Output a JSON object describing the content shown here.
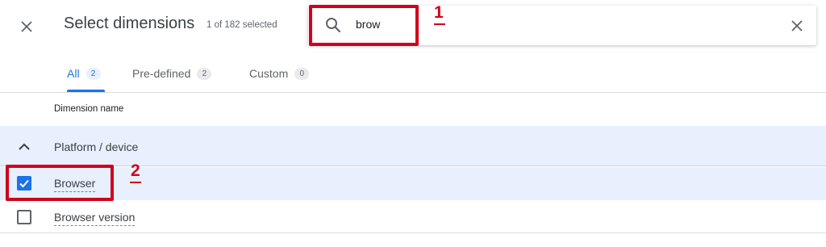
{
  "header": {
    "title": "Select dimensions",
    "selected_count": "1 of 182 selected"
  },
  "search": {
    "value": "brow",
    "icon": "search-icon",
    "clear_icon": "close-icon"
  },
  "tabs": [
    {
      "label": "All",
      "count": "2",
      "active": true
    },
    {
      "label": "Pre-defined",
      "count": "2",
      "active": false
    },
    {
      "label": "Custom",
      "count": "0",
      "active": false
    }
  ],
  "table": {
    "column_header": "Dimension name",
    "group": {
      "label": "Platform / device",
      "expanded": true
    },
    "items": [
      {
        "label": "Browser",
        "checked": true
      },
      {
        "label": "Browser version",
        "checked": false
      }
    ]
  },
  "annotations": [
    {
      "label": "1"
    },
    {
      "label": "2"
    }
  ],
  "colors": {
    "accent": "#1a73e8",
    "selected_row": "#e8f0fe",
    "annotation": "#d0021b"
  }
}
